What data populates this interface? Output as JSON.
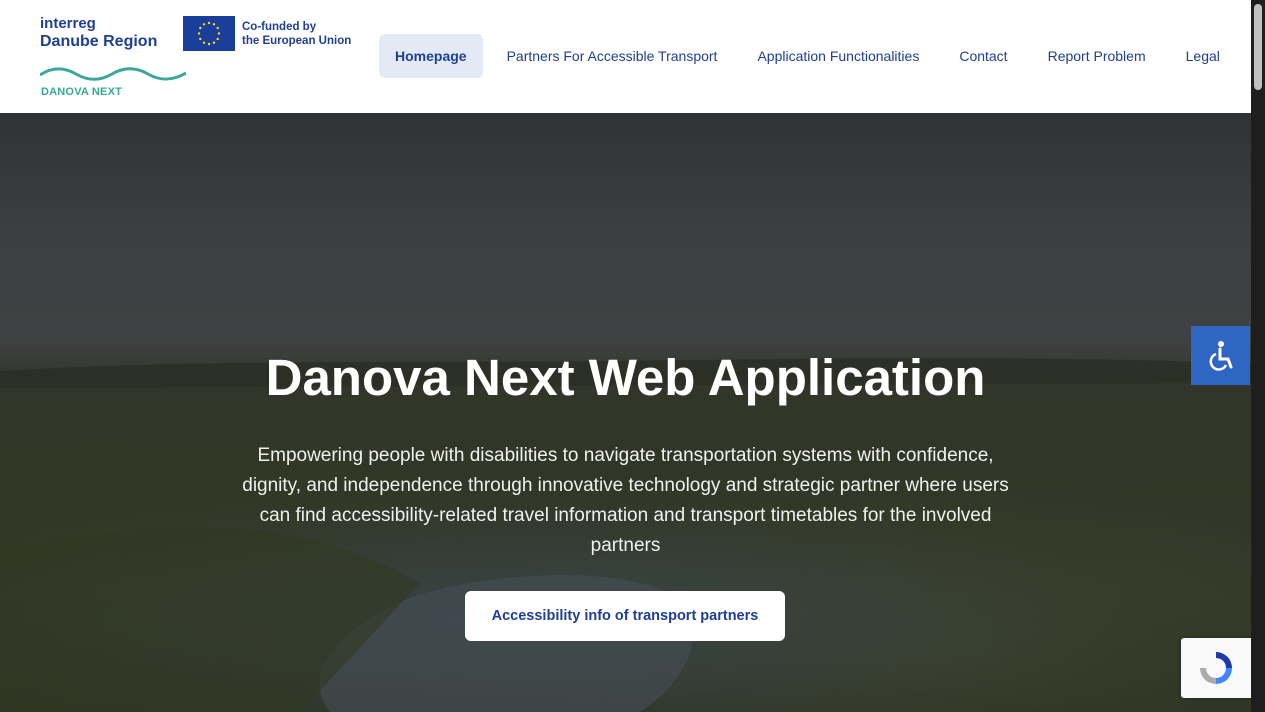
{
  "header": {
    "logo": {
      "brand_line1": "interreg",
      "brand_line2": "Danube Region",
      "eu_text_line1": "Co-funded by",
      "eu_text_line2": "the European Union",
      "project": "DANOVA NEXT"
    },
    "nav": [
      {
        "label": "Homepage",
        "active": true
      },
      {
        "label": "Partners For Accessible Transport",
        "active": false
      },
      {
        "label": "Application Functionalities",
        "active": false
      },
      {
        "label": "Contact",
        "active": false
      },
      {
        "label": "Report Problem",
        "active": false
      },
      {
        "label": "Legal",
        "active": false
      }
    ]
  },
  "hero": {
    "title": "Danova Next Web Application",
    "subtitle": "Empowering people with disabilities to navigate transportation systems with confidence, dignity, and independence through innovative technology and strategic partner where users can find accessibility-related travel information and transport timetables for the involved partners",
    "cta_label": "Accessibility info of transport partners"
  },
  "widgets": {
    "accessibility_icon": "wheelchair-icon",
    "recaptcha_icon": "recaptcha-icon"
  },
  "colors": {
    "brand_blue": "#1f3f95",
    "nav_active_bg": "#e3eaf6",
    "accessibility_blue": "#2f66c4",
    "danova_teal": "#3aa79a"
  }
}
